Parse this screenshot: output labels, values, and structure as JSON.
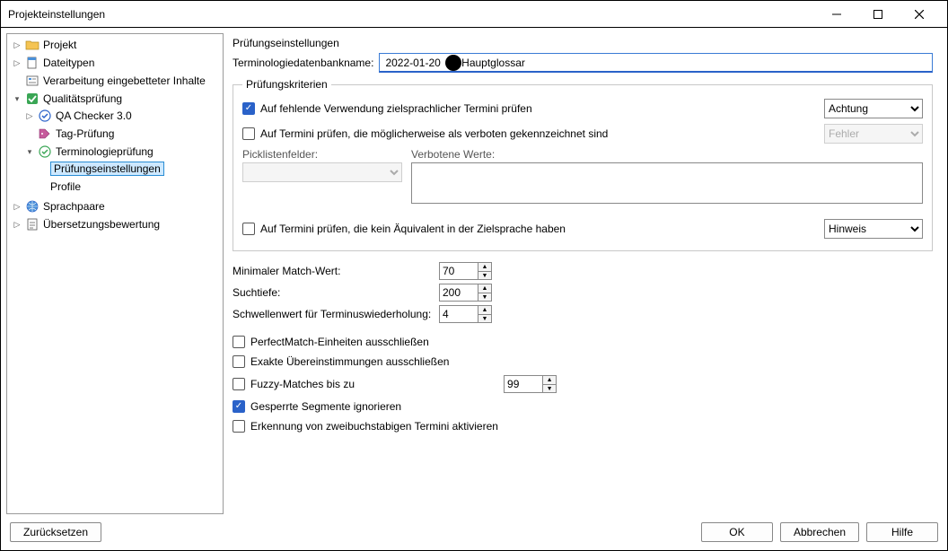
{
  "window": {
    "title": "Projekteinstellungen"
  },
  "tree": {
    "projekt": "Projekt",
    "dateitypen": "Dateitypen",
    "verarbeitung": "Verarbeitung eingebetteter Inhalte",
    "qualitaet": "Qualitätsprüfung",
    "qa_checker": "QA Checker 3.0",
    "tag_pruefung": "Tag-Prüfung",
    "terminologie": "Terminologieprüfung",
    "pruefeinst": "Prüfungseinstellungen",
    "profile": "Profile",
    "sprachpaare": "Sprachpaare",
    "uebersetzung": "Übersetzungsbewertung"
  },
  "content": {
    "section_title": "Prüfungseinstellungen",
    "db_label": "Terminologiedatenbankname:",
    "db_value": "2022-01-20       Hauptglossar",
    "criteria_legend": "Prüfungskriterien",
    "crit1": "Auf fehlende Verwendung zielsprachlicher Termini prüfen",
    "crit1_level": "Achtung",
    "crit2": "Auf Termini prüfen, die möglicherweise als verboten gekennzeichnet sind",
    "crit2_level": "Fehler",
    "picklist_label": "Picklistenfelder:",
    "forbidden_label": "Verbotene Werte:",
    "crit3": "Auf Termini prüfen, die kein Äquivalent in der Zielsprache haben",
    "crit3_level": "Hinweis",
    "min_match_label": "Minimaler Match-Wert:",
    "min_match_value": "70",
    "search_depth_label": "Suchtiefe:",
    "search_depth_value": "200",
    "threshold_label": "Schwellenwert für Terminuswiederholung:",
    "threshold_value": "4",
    "opt_perfect": "PerfectMatch-Einheiten ausschließen",
    "opt_exact": "Exakte Übereinstimmungen ausschließen",
    "opt_fuzzy": "Fuzzy-Matches bis zu",
    "opt_fuzzy_value": "99",
    "opt_locked": "Gesperrte Segmente ignorieren",
    "opt_twoletter": "Erkennung von zweibuchstabigen Termini aktivieren"
  },
  "footer": {
    "reset": "Zurücksetzen",
    "ok": "OK",
    "cancel": "Abbrechen",
    "help": "Hilfe"
  }
}
